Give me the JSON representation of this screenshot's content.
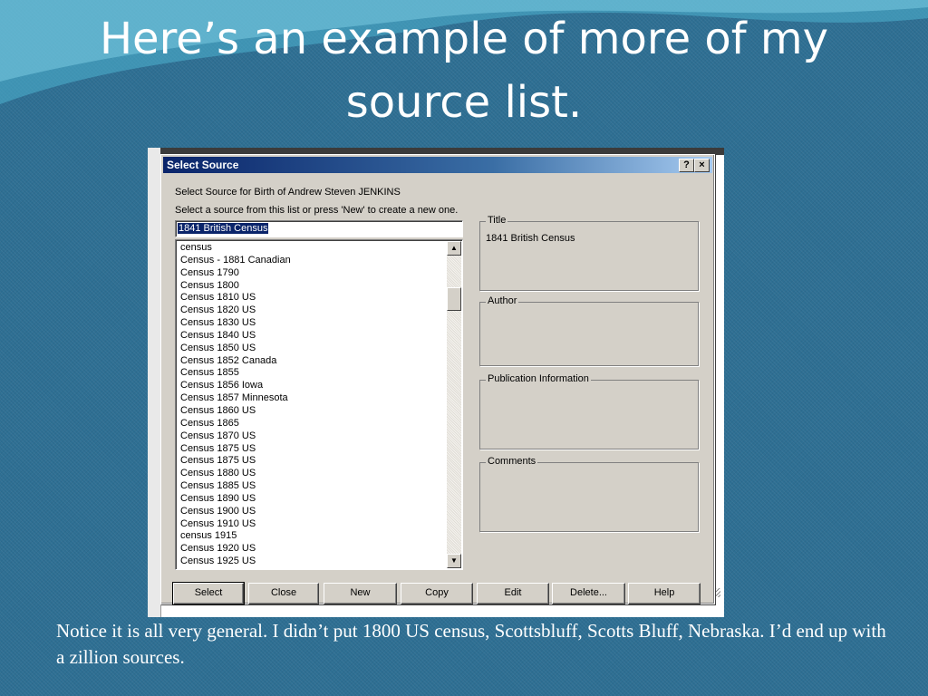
{
  "slide": {
    "title": "Here’s an example of more of my source list.",
    "caption": "Notice it is all very general.  I didn’t put 1800 US census, Scottsbluff, Scotts Bluff, Nebraska.  I’d end up with a zillion sources."
  },
  "dialog": {
    "title": "Select Source",
    "help_label": "?",
    "close_label": "×",
    "heading": "Select Source for Birth of Andrew Steven JENKINS",
    "instruction": "Select a source from this list or press 'New' to create a new one.",
    "search_value": "1841 British Census",
    "list_items": [
      "census",
      "Census - 1881 Canadian",
      "Census 1790",
      "Census 1800",
      "Census 1810 US",
      "Census 1820 US",
      "Census 1830 US",
      "Census 1840 US",
      "Census 1850 US",
      "Census 1852 Canada",
      "Census 1855",
      "Census 1856 Iowa",
      "Census 1857 Minnesota",
      "Census 1860 US",
      "Census 1865",
      "Census 1870 US",
      "Census 1875 US",
      "Census 1875 US",
      "Census 1880 US",
      "Census 1885 US",
      "Census 1890 US",
      "Census 1900 US",
      "Census 1910 US",
      "census 1915",
      "Census 1920 US",
      "Census 1925 US"
    ],
    "scroll_up_icon": "▲",
    "scroll_down_icon": "▼",
    "groups": {
      "title_label": "Title",
      "title_value": "1841 British Census",
      "author_label": "Author",
      "publication_label": "Publication Information",
      "comments_label": "Comments"
    },
    "buttons": {
      "select": "Select",
      "close": "Close",
      "new": "New",
      "copy": "Copy",
      "edit": "Edit",
      "delete": "Delete...",
      "help": "Help"
    }
  }
}
